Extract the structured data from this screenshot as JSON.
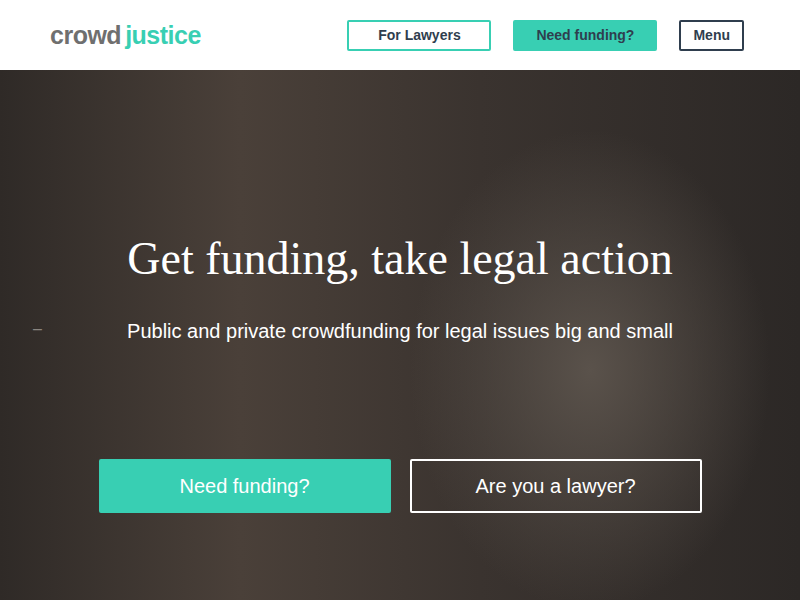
{
  "header": {
    "logo": {
      "first": "crowd",
      "second": "justice"
    },
    "buttons": [
      {
        "label": "For Lawyers",
        "kind": "outline"
      },
      {
        "label": "Need funding?",
        "kind": "filled"
      },
      {
        "label": "Menu",
        "kind": "dark"
      }
    ]
  },
  "hero": {
    "title": "Get funding, take legal action",
    "subtitle": "Public and private crowdfunding for legal issues big and small",
    "control": "–",
    "buttons": [
      {
        "label": "Need funding?",
        "kind": "filled"
      },
      {
        "label": "Are you a lawyer?",
        "kind": "outline"
      }
    ]
  }
}
